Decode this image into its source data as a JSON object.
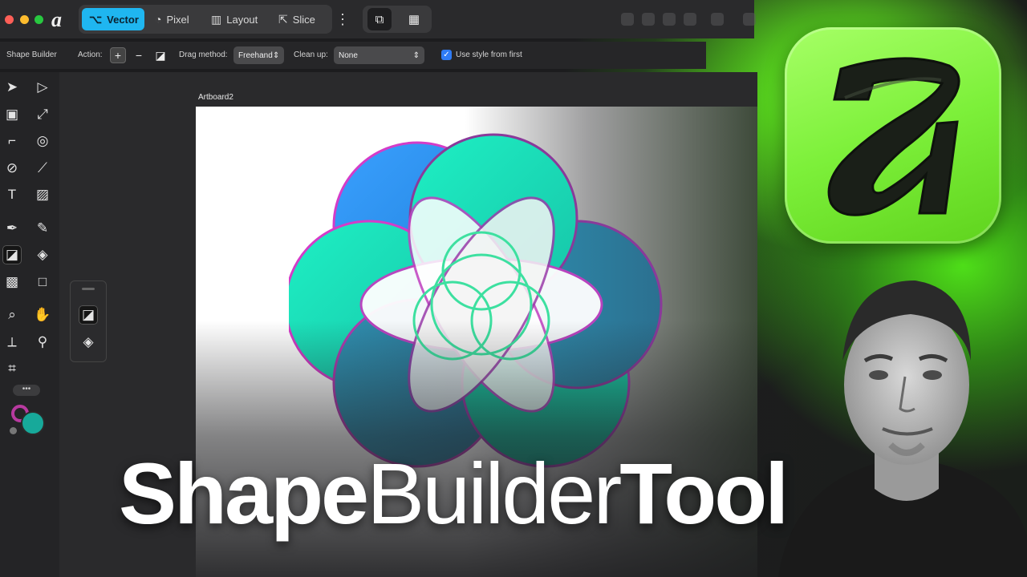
{
  "topbar": {
    "app_logo": "a",
    "personas": [
      {
        "label": "Vector",
        "icon": "vector-nodes-icon",
        "active": true
      },
      {
        "label": "Pixel",
        "icon": "pixel-circle-icon",
        "active": false
      },
      {
        "label": "Layout",
        "icon": "layout-columns-icon",
        "active": false
      },
      {
        "label": "Slice",
        "icon": "slice-export-icon",
        "active": false
      }
    ]
  },
  "context_bar": {
    "tool_name": "Shape Builder",
    "action_label": "Action:",
    "drag_method_label": "Drag method:",
    "drag_method_value": "Freehand",
    "clean_up_label": "Clean up:",
    "clean_up_value": "None",
    "use_style_label": "Use style from first",
    "use_style_checked": true
  },
  "canvas": {
    "artboard_label": "Artboard2"
  },
  "colors": {
    "accent": "#1fb6f0",
    "stroke": "#b83aa0",
    "fill": "#17a99a",
    "brand_green": "#7df03a"
  },
  "overlay_title": {
    "part1": "Shape",
    "part2": "Builder",
    "part3": "Tool"
  }
}
